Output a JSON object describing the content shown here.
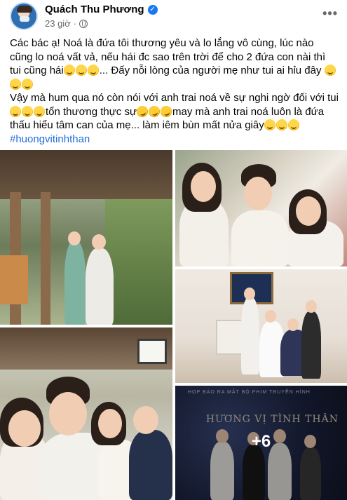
{
  "post": {
    "author": "Quách Thu Phương",
    "time": "23 giờ",
    "more_label": "•••",
    "verified_mark": "✓",
    "text_line1": "Các bác ạ! Noá là đứa tôi thương yêu và lo lắng vô cùng, lúc nào cũng lo noá vất vả, nếu hái đc sao trên trời để cho 2 đứa con nài thì tui cũng hái",
    "text_line1_tail": "... Đấy nỗi lòng của người mẹ như tui ai hỉu đây",
    "text_line2_head": "Vậy mà hum qua nó còn nói với anh trai noá về sự nghi ngờ đối với tui",
    "text_line2_mid1": "tổn thương thực sự",
    "text_line2_mid2": "may mà anh trai noá luôn là đứa thấu hiểu tâm can của mẹ... làm iêm bùn mất nửa giây",
    "hashtag": "#huongvitinhthan"
  },
  "photos": {
    "more_count": "+6",
    "poster_title": "HƯƠNG VỊ TÌNH THÂN",
    "poster_subtitle": "HỌP BÁO RA MẮT BỘ PHIM TRUYỀN HÌNH"
  },
  "colors": {
    "link": "#216fdb",
    "secondary_text": "#65676b",
    "verified": "#1877f2"
  }
}
